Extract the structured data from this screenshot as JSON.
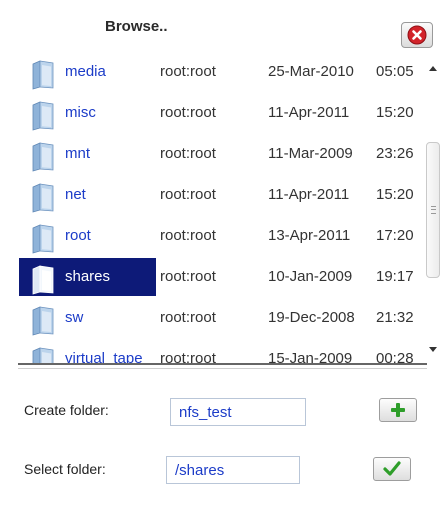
{
  "dialog": {
    "title": "Browse.."
  },
  "colors": {
    "link": "#1c3cc8",
    "selection": "#0d1a78",
    "close_red": "#d2232a",
    "ok_green": "#2e9e2a"
  },
  "files": [
    {
      "name": "media",
      "owner": "root:root",
      "date": "25-Mar-2010",
      "time": "05:05",
      "selected": false
    },
    {
      "name": "misc",
      "owner": "root:root",
      "date": "11-Apr-2011",
      "time": "15:20",
      "selected": false
    },
    {
      "name": "mnt",
      "owner": "root:root",
      "date": "11-Mar-2009",
      "time": "23:26",
      "selected": false
    },
    {
      "name": "net",
      "owner": "root:root",
      "date": "11-Apr-2011",
      "time": "15:20",
      "selected": false
    },
    {
      "name": "root",
      "owner": "root:root",
      "date": "13-Apr-2011",
      "time": "17:20",
      "selected": false
    },
    {
      "name": "shares",
      "owner": "root:root",
      "date": "10-Jan-2009",
      "time": "19:17",
      "selected": true
    },
    {
      "name": "sw",
      "owner": "root:root",
      "date": "19-Dec-2008",
      "time": "21:32",
      "selected": false
    },
    {
      "name": "virtual_tape",
      "owner": "root:root",
      "date": "15-Jan-2009",
      "time": "00:28",
      "selected": false
    }
  ],
  "create_folder": {
    "label": "Create folder:",
    "value": "nfs_test",
    "button_icon": "plus-icon"
  },
  "select_folder": {
    "label": "Select folder:",
    "value": "/shares",
    "button_icon": "checkmark-icon"
  }
}
